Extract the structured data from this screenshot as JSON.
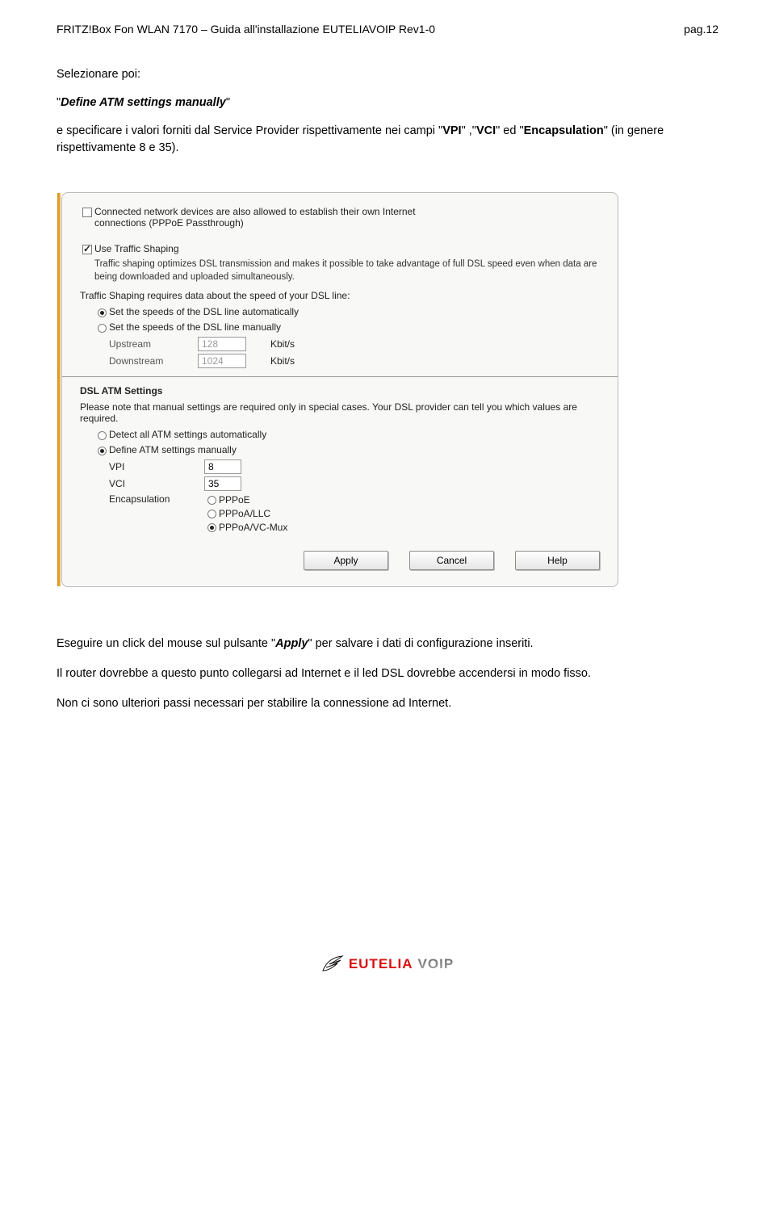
{
  "header": {
    "left": "FRITZ!Box Fon WLAN 7170 – Guida all'installazione EUTELIAVOIP Rev1-0",
    "right": "pag.12"
  },
  "intro": {
    "p1": "Selezionare poi:",
    "quote_open": "\"",
    "quote_close": "\"",
    "setting_name": "Define ATM settings manually",
    "p3_a": "e specificare i valori forniti dal Service Provider  rispettivamente nei campi \"",
    "vpi": "VPI",
    "p3_b": "\" ,\"",
    "vci": "VCI",
    "p3_c": "\" ed \"",
    "encap": "Encapsulation",
    "p3_d": "\" (in genere rispettivamente 8 e 35)."
  },
  "panel": {
    "pppoe_pass_a": "Connected network devices are also allowed to establish their own Internet",
    "pppoe_pass_b": "connections (PPPoE Passthrough)",
    "ts_title": "Use Traffic Shaping",
    "ts_desc": "Traffic shaping optimizes DSL transmission and makes it possible to take advantage of full DSL speed even when data are being downloaded and uploaded simultaneously.",
    "ts_note": "Traffic Shaping requires data about the speed of your DSL line:",
    "ts_opt_auto": "Set the speeds of the DSL line automatically",
    "ts_opt_manual": "Set the speeds of the DSL line manually",
    "up_label": "Upstream",
    "up_val": "128",
    "down_label": "Downstream",
    "down_val": "1024",
    "kbits": "Kbit/s",
    "atm_title": "DSL ATM Settings",
    "atm_desc": "Please note that manual settings are required only in special cases. Your DSL provider can tell you which values are required.",
    "atm_opt_auto": "Detect all ATM settings automatically",
    "atm_opt_manual": "Define ATM settings manually",
    "vpi_label": "VPI",
    "vpi_val": "8",
    "vci_label": "VCI",
    "vci_val": "35",
    "encap_label": "Encapsulation",
    "encap_opts": {
      "pppoe": "PPPoE",
      "pppoallc": "PPPoA/LLC",
      "pppoavc": "PPPoA/VC-Mux"
    },
    "btn_apply": "Apply",
    "btn_cancel": "Cancel",
    "btn_help": "Help"
  },
  "after": {
    "p1_a": "Eseguire un click del mouse sul pulsante \"",
    "apply": "Apply",
    "p1_b": "\" per salvare i dati di configurazione inseriti.",
    "p2": "Il router dovrebbe a questo punto collegarsi ad Internet e il led DSL dovrebbe accendersi in modo fisso.",
    "p3": "Non ci sono ulteriori passi necessari per stabilire la connessione ad Internet."
  },
  "logo": {
    "a": "EUTELIA",
    "b": "VOIP"
  }
}
